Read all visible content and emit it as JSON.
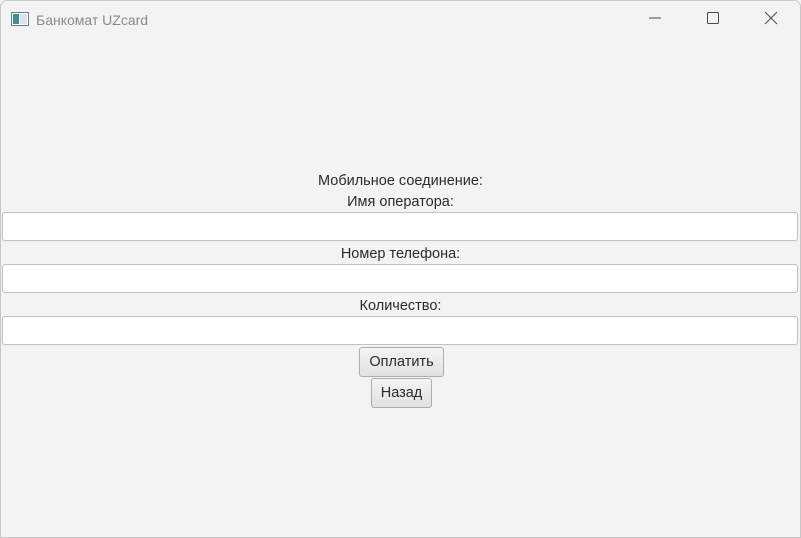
{
  "window": {
    "title": "Банкомат UZcard",
    "app_icon": "app-window-icon",
    "controls": {
      "minimize_icon": "minimize-icon",
      "maximize_icon": "maximize-icon",
      "close_icon": "close-icon"
    }
  },
  "form": {
    "heading": "Мобильное соединение:",
    "operator_label": "Имя оператора:",
    "operator_value": "",
    "phone_label": "Номер телефона:",
    "phone_value": "",
    "amount_label": "Количество:",
    "amount_value": "",
    "pay_button": "Оплатить",
    "back_button": "Назад"
  },
  "colors": {
    "background": "#f3f3f3",
    "title_text": "#8a8a8a",
    "text": "#2b2b2b",
    "field_border": "#c2c2c2"
  }
}
